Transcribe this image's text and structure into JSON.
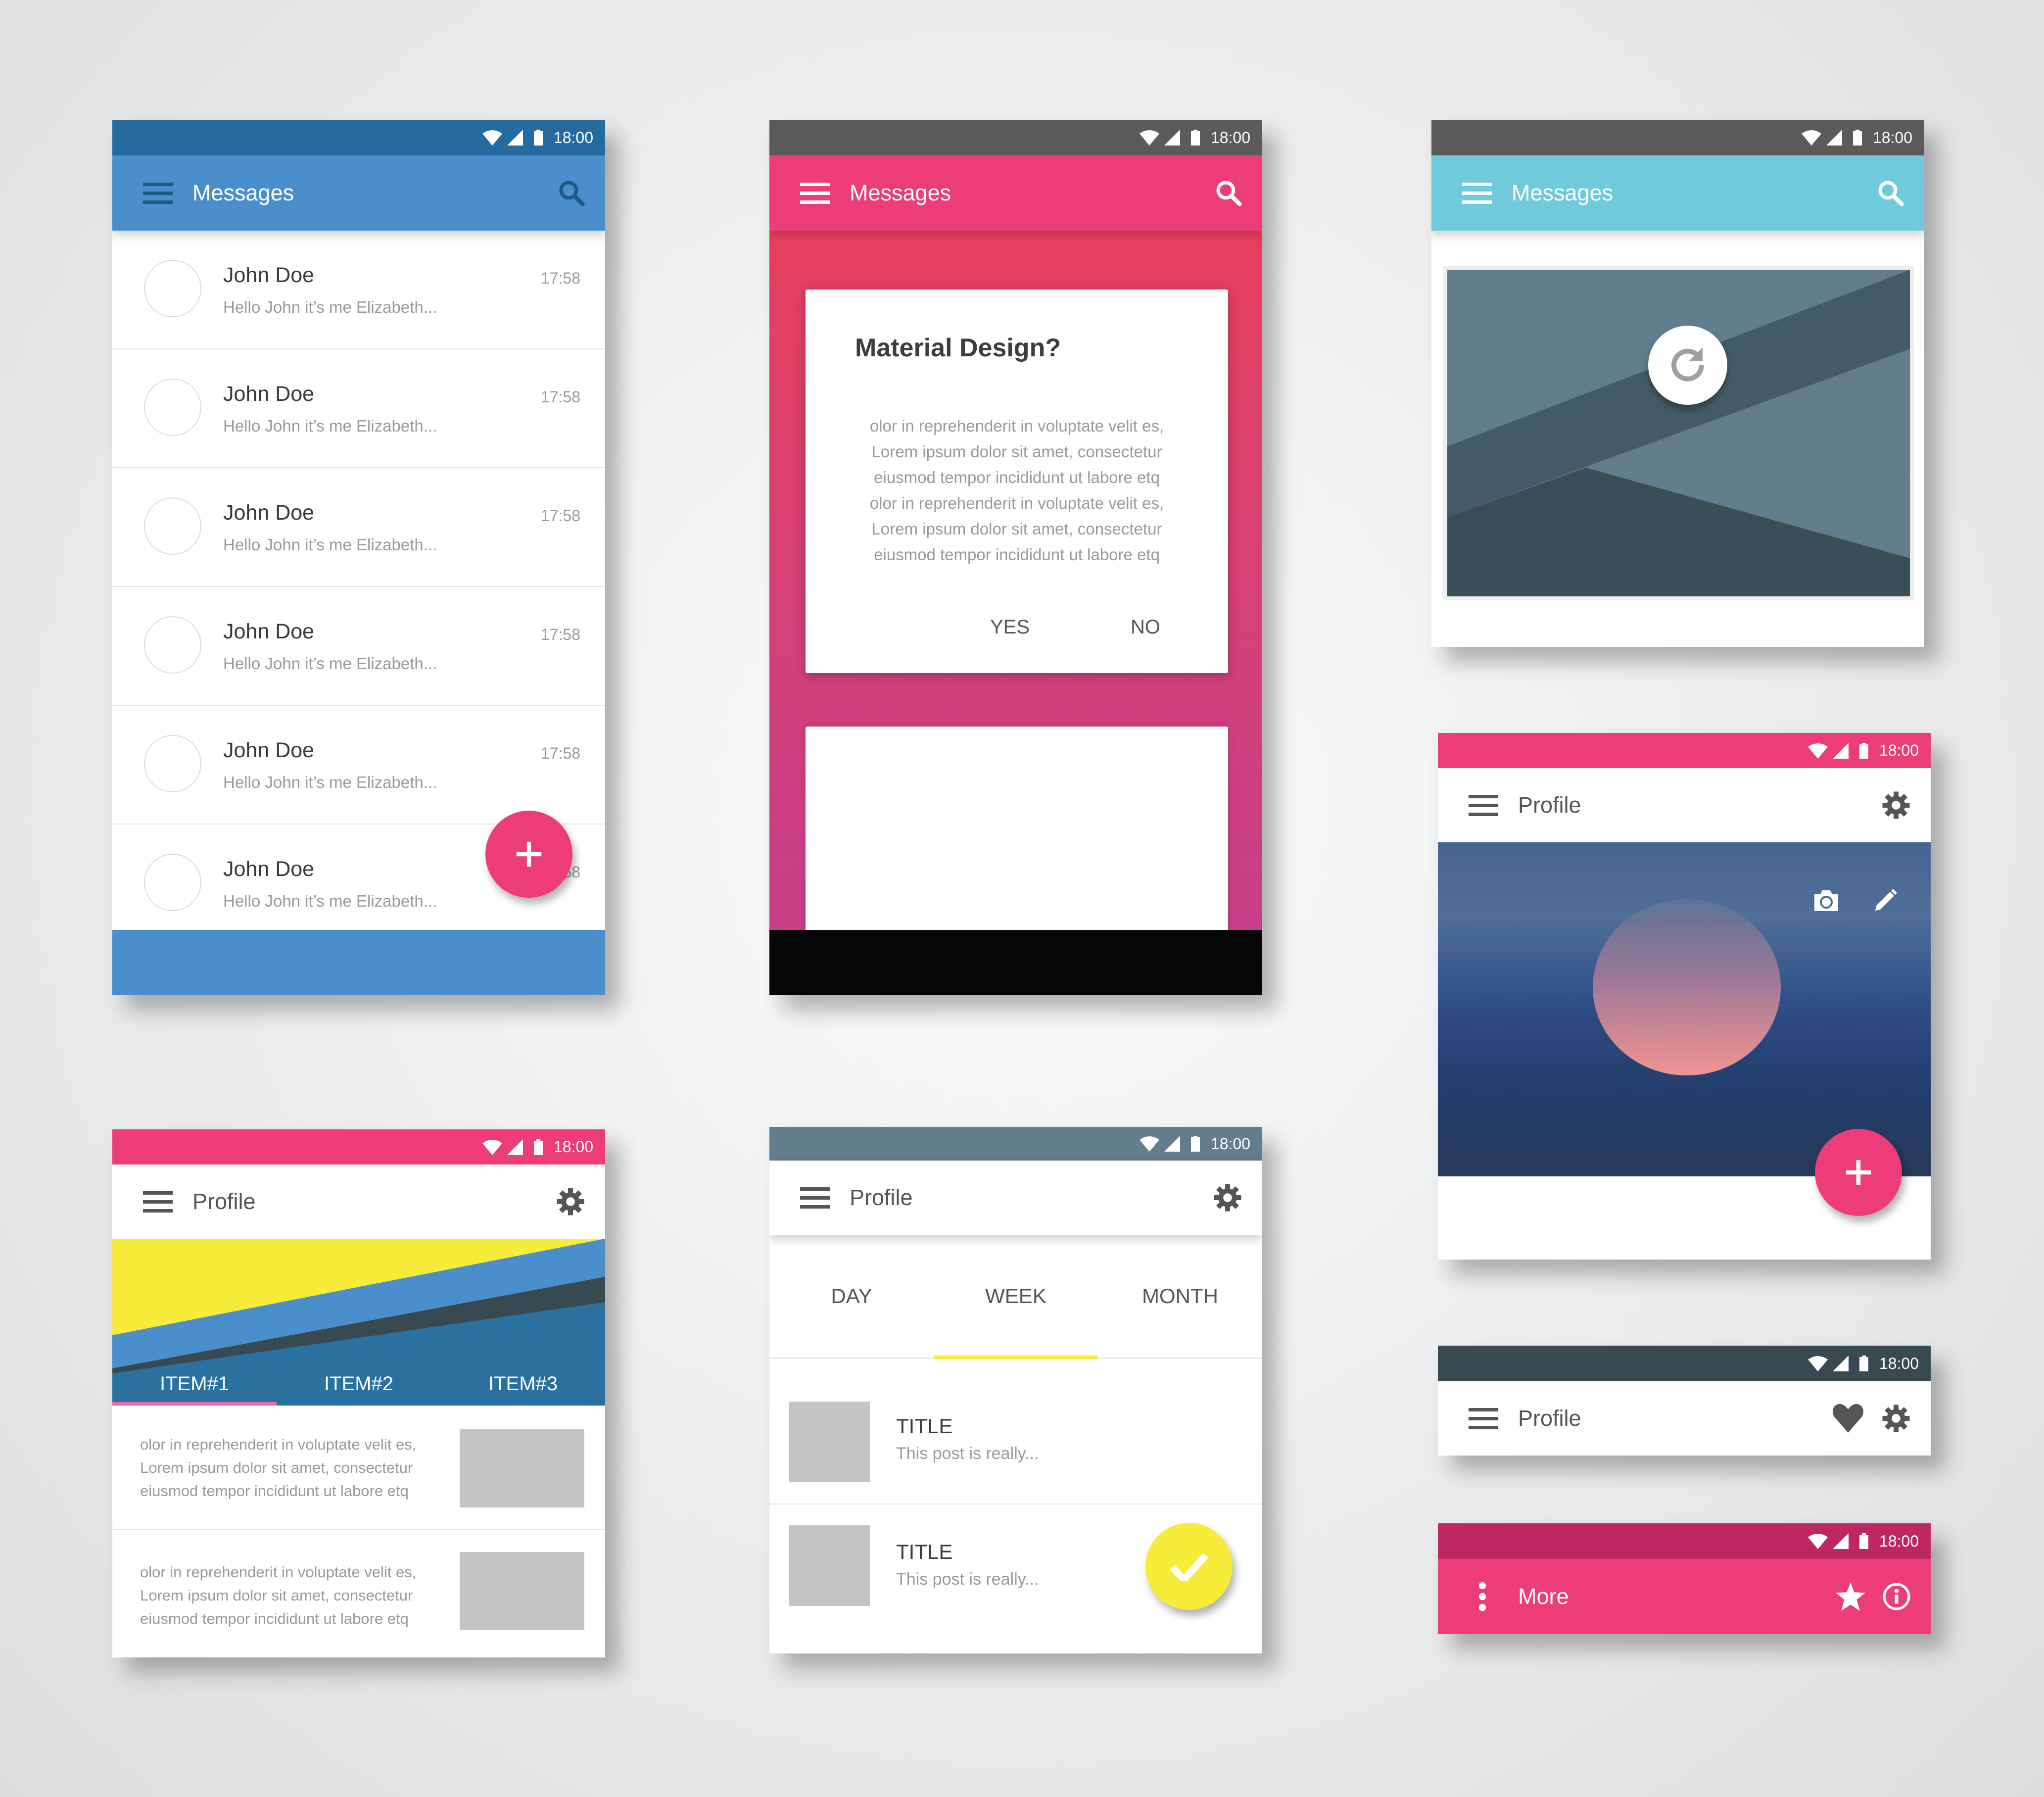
{
  "status_bar": {
    "time": "18:00",
    "icons": [
      "wifi-icon",
      "signal-icon",
      "battery-icon"
    ]
  },
  "colors": {
    "blue_primary": "#4a8fcb",
    "blue_dark": "#256ba0",
    "pink": "#ec3c7a",
    "pink_dark": "#bd2762",
    "cyan": "#6fcbdc",
    "gray_status": "#5b5b5b",
    "slate": "#627d8b",
    "slate_dark": "#374a52",
    "yellow": "#f8ec3a"
  },
  "screen_messages_list": {
    "title": "Messages",
    "menu_icon": "menu-icon",
    "search_icon": "search-icon",
    "fab_icon": "plus-icon",
    "messages": [
      {
        "name": "John Doe",
        "preview": "Hello John it’s me Elizabeth...",
        "time": "17:58"
      },
      {
        "name": "John Doe",
        "preview": "Hello John it’s me Elizabeth...",
        "time": "17:58"
      },
      {
        "name": "John Doe",
        "preview": "Hello John it’s me Elizabeth...",
        "time": "17:58"
      },
      {
        "name": "John Doe",
        "preview": "Hello John it’s me Elizabeth...",
        "time": "17:58"
      },
      {
        "name": "John Doe",
        "preview": "Hello John it’s me Elizabeth...",
        "time": "17:58"
      },
      {
        "name": "John Doe",
        "preview": "Hello John it’s me Elizabeth...",
        "time": "17:58"
      }
    ]
  },
  "screen_dialog": {
    "title": "Messages",
    "dialog": {
      "heading": "Material Design?",
      "body_lines": [
        "olor in reprehenderit in voluptate velit es,",
        "Lorem ipsum dolor sit amet, consectetur",
        "eiusmod tempor incididunt ut labore etq",
        "olor in reprehenderit in voluptate velit es,",
        "Lorem ipsum dolor sit amet, consectetur",
        "eiusmod tempor incididunt ut labore etq"
      ],
      "yes_label": "YES",
      "no_label": "NO"
    }
  },
  "screen_image_card": {
    "title": "Messages",
    "reload_icon": "refresh-icon"
  },
  "screen_profile_hero": {
    "title": "Profile",
    "settings_icon": "gear-icon",
    "camera_icon": "camera-icon",
    "edit_icon": "pencil-icon",
    "fab_icon": "plus-icon"
  },
  "screen_profile_tabs": {
    "title": "Profile",
    "tabs": [
      {
        "label": "ITEM#1",
        "active": true
      },
      {
        "label": "ITEM#2",
        "active": false
      },
      {
        "label": "ITEM#3",
        "active": false
      }
    ],
    "items": [
      {
        "lines": [
          "olor in reprehenderit in voluptate velit es,",
          "Lorem ipsum dolor sit amet, consectetur",
          "eiusmod tempor incididunt ut labore etq"
        ]
      },
      {
        "lines": [
          "olor in reprehenderit in voluptate velit es,",
          "Lorem ipsum dolor sit amet, consectetur",
          "eiusmod tempor incididunt ut labore etq"
        ]
      }
    ]
  },
  "screen_profile_periods": {
    "title": "Profile",
    "tabs": [
      {
        "label": "DAY",
        "active": false
      },
      {
        "label": "WEEK",
        "active": true
      },
      {
        "label": "MONTH",
        "active": false
      }
    ],
    "posts": [
      {
        "title": "TITLE",
        "subtitle": "This post is really..."
      },
      {
        "title": "TITLE",
        "subtitle": "This post is really..."
      }
    ],
    "fab_icon": "check-icon"
  },
  "bar_profile": {
    "title": "Profile",
    "icons": [
      "heart-icon",
      "gear-icon"
    ]
  },
  "bar_more": {
    "title": "More",
    "icons": [
      "star-icon",
      "info-icon"
    ],
    "menu_icon": "more-vert-icon"
  }
}
